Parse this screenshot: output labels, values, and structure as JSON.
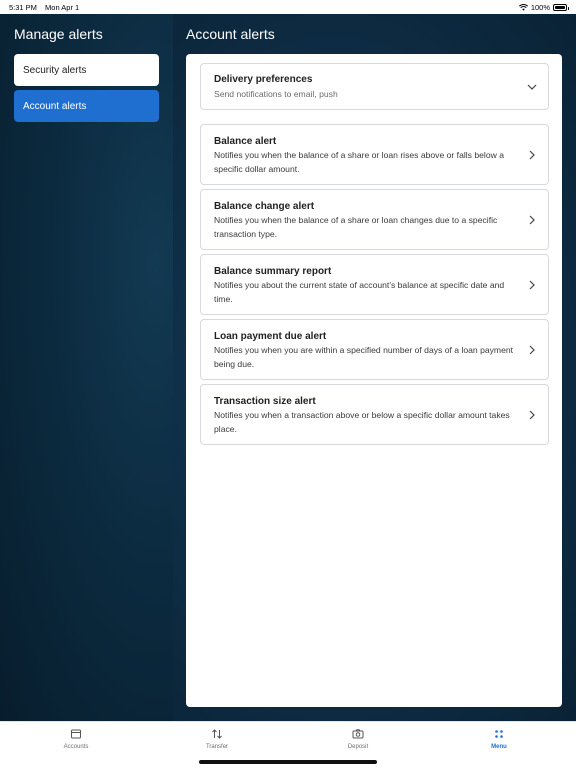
{
  "status": {
    "time": "5:31 PM",
    "date": "Mon Apr 1",
    "battery": "100%"
  },
  "sidebar": {
    "title": "Manage alerts",
    "items": [
      {
        "label": "Security alerts",
        "active": false
      },
      {
        "label": "Account alerts",
        "active": true
      }
    ]
  },
  "main": {
    "title": "Account alerts",
    "delivery": {
      "title": "Delivery preferences",
      "subtitle": "Send notifications to email, push"
    },
    "alerts": [
      {
        "title": "Balance alert",
        "description": "Notifies you when the balance of a share or loan rises above or falls below a specific dollar amount."
      },
      {
        "title": "Balance change alert",
        "description": "Notifies you when the balance of a share or loan changes due to a specific transaction type."
      },
      {
        "title": "Balance summary report",
        "description": "Notifies you about the current state of account's balance at specific date and time."
      },
      {
        "title": "Loan payment due alert",
        "description": "Notifies you when you are within a specified number of days of a loan payment being due."
      },
      {
        "title": "Transaction size alert",
        "description": "Notifies you when a transaction above or below a specific dollar amount takes place."
      }
    ]
  },
  "tabbar": {
    "tabs": [
      {
        "label": "Accounts",
        "icon": "wallet-icon"
      },
      {
        "label": "Transfer",
        "icon": "transfer-arrows-icon"
      },
      {
        "label": "Deposit",
        "icon": "camera-icon"
      },
      {
        "label": "Menu",
        "icon": "menu-dots-icon"
      }
    ],
    "active_tab": "Menu"
  },
  "colors": {
    "accent": "#1e6fd0",
    "sidebar_bg": "#0c2b40",
    "main_bg": "#0f3049"
  }
}
